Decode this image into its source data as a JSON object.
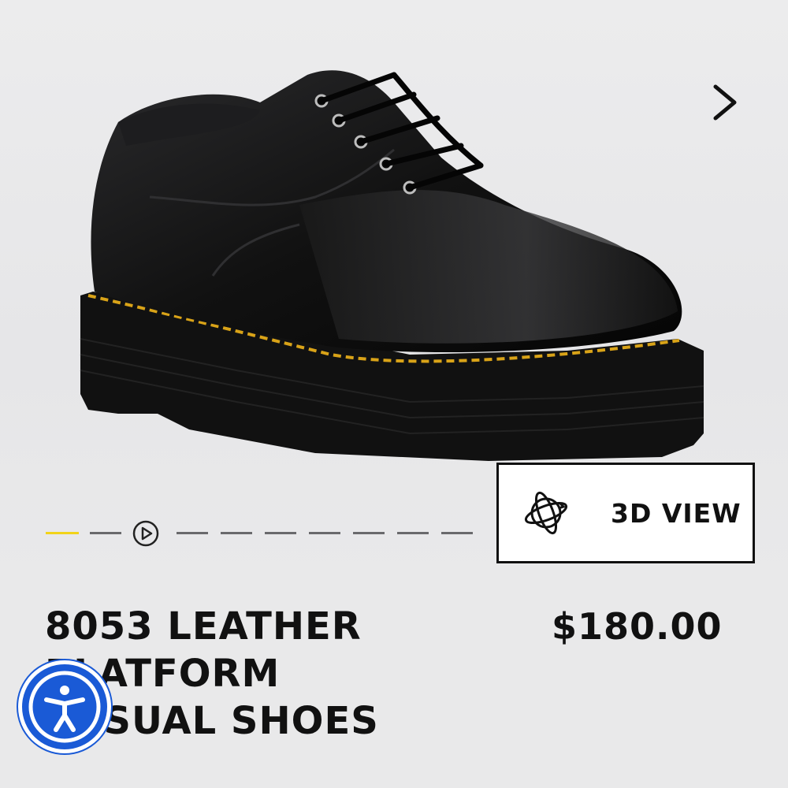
{
  "gallery": {
    "image_alt": "black leather platform shoe with yellow welt stitching",
    "next_icon": "chevron-right-icon",
    "play_icon": "play-circle-icon",
    "slides_total": 11,
    "active_slide": 1
  },
  "view3d": {
    "icon": "rotate-3d-icon",
    "label": "3D VIEW"
  },
  "product": {
    "title_lines": [
      "8053 LEATHER",
      "PLATFORM",
      "CASUAL SHOES"
    ],
    "price": "$180.00"
  },
  "accessibility": {
    "icon": "accessibility-person-icon"
  },
  "colors": {
    "background": "#e9e9ea",
    "active_indicator": "#f2d31a",
    "accessibility_blue": "#1a5ad6",
    "text": "#111111"
  }
}
